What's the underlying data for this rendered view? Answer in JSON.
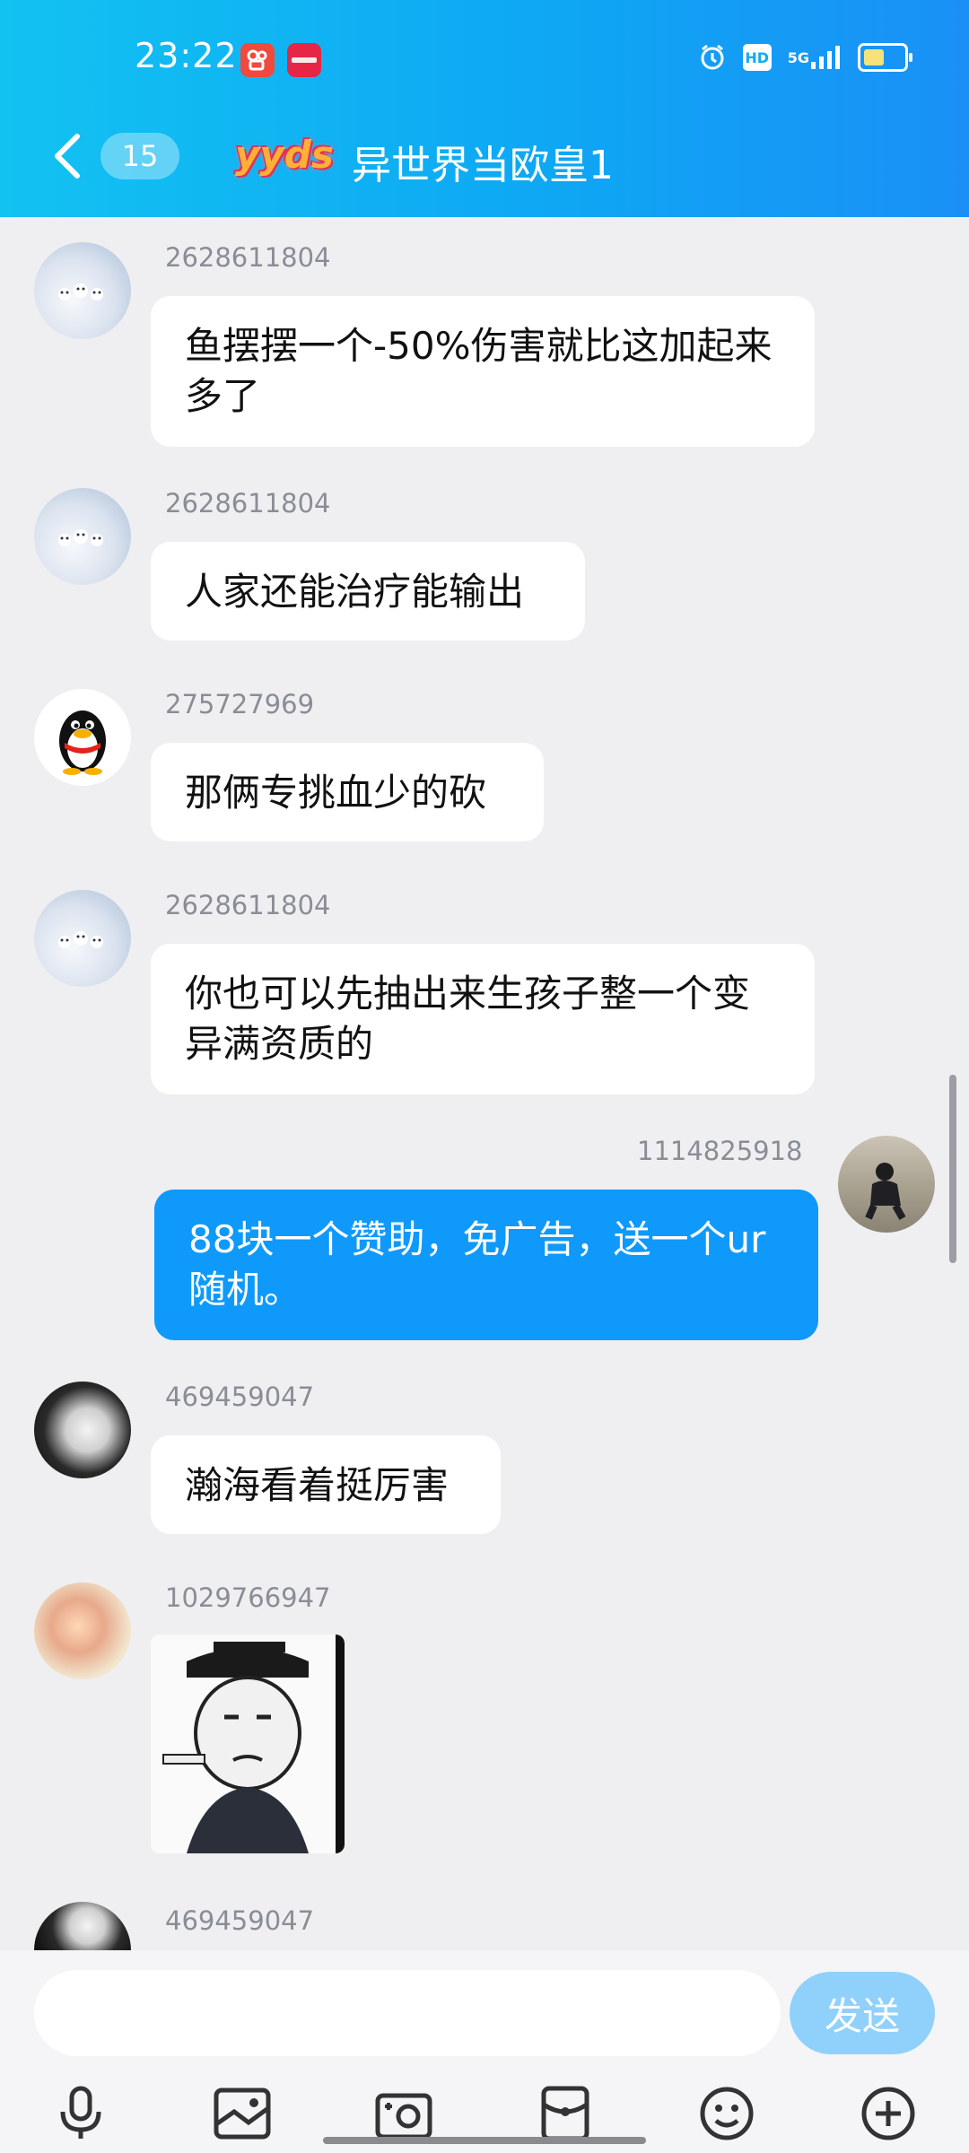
{
  "status_bar": {
    "time": "23:22",
    "app_badges": [
      "kuaishou-icon",
      "xiaohongshu-icon"
    ],
    "signal_label": "5G",
    "hd_label": "HD"
  },
  "header": {
    "unread_count": "15",
    "logo_text": "yyds",
    "title": "异世界当欧皇1"
  },
  "messages": [
    {
      "sender": "2628611804",
      "text": "鱼摆摆一个-50%伤害就比这加起来多了",
      "side": "left",
      "avatar": "cloud"
    },
    {
      "sender": "2628611804",
      "text": "人家还能治疗能输出",
      "side": "left",
      "avatar": "cloud"
    },
    {
      "sender": "275727969",
      "text": "那俩专挑血少的砍",
      "side": "left",
      "avatar": "qq-penguin"
    },
    {
      "sender": "2628611804",
      "text": "你也可以先抽出来生孩子整一个变异满资质的",
      "side": "left",
      "avatar": "cloud"
    },
    {
      "sender": "1114825918",
      "text": "88块一个赞助，免广告，送一个ur随机。",
      "side": "right",
      "avatar": "photo"
    },
    {
      "sender": "469459047",
      "text": "瀚海看着挺厉害",
      "side": "left",
      "avatar": "hood"
    },
    {
      "sender": "1029766947",
      "text": "",
      "side": "left",
      "avatar": "anime",
      "sticker": "meme-sticker"
    },
    {
      "sender": "469459047",
      "text": "",
      "side": "left",
      "avatar": "hood"
    }
  ],
  "composer": {
    "placeholder": "",
    "send_label": "发送"
  },
  "toolbar": [
    "microphone-icon",
    "image-icon",
    "camera-icon",
    "red-packet-icon",
    "emoji-icon",
    "plus-icon"
  ],
  "colors": {
    "header_start": "#12c2f1",
    "header_end": "#1a90f6",
    "my_bubble": "#0f99fb",
    "send_button": "#8fd1fb"
  }
}
